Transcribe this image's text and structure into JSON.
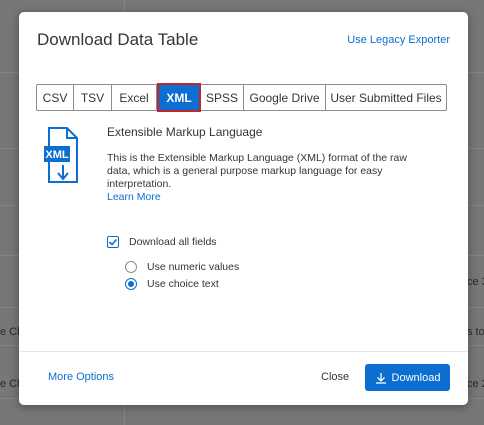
{
  "background": {
    "fragments": [
      "ce 3",
      "e Ch",
      "s to",
      "e Ch",
      "ce 2"
    ]
  },
  "modal": {
    "title": "Download Data Table",
    "legacy_link": "Use Legacy Exporter",
    "tabs": [
      {
        "label": "CSV",
        "active": false
      },
      {
        "label": "TSV",
        "active": false
      },
      {
        "label": "Excel",
        "active": false
      },
      {
        "label": "XML",
        "active": true
      },
      {
        "label": "SPSS",
        "active": false
      },
      {
        "label": "Google Drive",
        "active": false
      },
      {
        "label": "User Submitted Files",
        "active": false
      }
    ],
    "format": {
      "icon_name": "xml-file-icon",
      "icon_text": "XML",
      "title": "Extensible Markup Language",
      "description": "This is the Extensible Markup Language (XML) format of the raw data, which is a general purpose markup language for easy interpretation.",
      "learn_more": "Learn More"
    },
    "options": {
      "download_all_fields": {
        "label": "Download all fields",
        "checked": true
      },
      "radios": [
        {
          "label": "Use numeric values",
          "checked": false
        },
        {
          "label": "Use choice text",
          "checked": true
        }
      ]
    },
    "footer": {
      "more_options": "More Options",
      "close": "Close",
      "download": "Download"
    }
  },
  "colors": {
    "accent": "#0b6ed0",
    "active_tab_outline": "#c0272d",
    "text": "#32363a",
    "overlay": "#777777"
  }
}
